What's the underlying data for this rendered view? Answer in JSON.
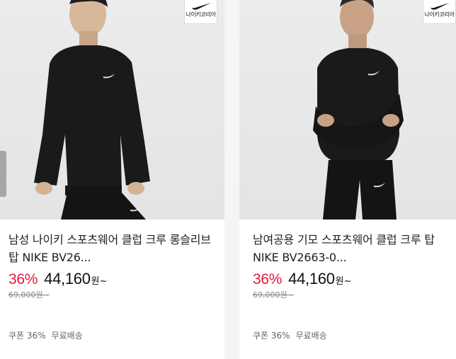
{
  "products": [
    {
      "brand_badge": "나이키코리아",
      "title": "남성 나이키 스포츠웨어 클럽 크루 롱슬리브 탑 NIKE BV26...",
      "discount": "36%",
      "price": "44,160",
      "price_unit": "원~",
      "original_price": "69,000원~",
      "tags": [
        "쿠폰 36%",
        "무료배송"
      ]
    },
    {
      "brand_badge": "나이키코리아",
      "title": "남여공용 기모 스포츠웨어 클럽 크루 탑 NIKE BV2663-0...",
      "discount": "36%",
      "price": "44,160",
      "price_unit": "원~",
      "original_price": "69,000원~",
      "tags": [
        "쿠폰 36%",
        "무료배송"
      ]
    }
  ],
  "colors": {
    "discount": "#e2183f",
    "text": "#222222",
    "muted": "#888888",
    "photo_bg": "#e8e8e8",
    "garment": "#1a1a1a"
  },
  "icons": [
    "nike-swoosh-icon"
  ]
}
